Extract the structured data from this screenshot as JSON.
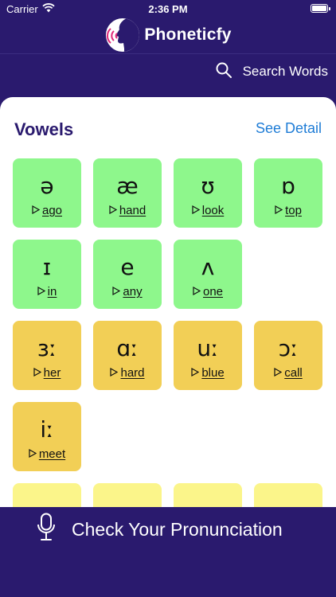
{
  "status": {
    "carrier": "Carrier",
    "time": "2:36 PM"
  },
  "header": {
    "title": "Phoneticfy"
  },
  "search": {
    "label": "Search Words"
  },
  "section": {
    "title": "Vowels",
    "detail_link": "See Detail"
  },
  "colors": {
    "green": "#8ef78c",
    "orange": "#f2cf56",
    "yellow": "#fbf58a",
    "brand": "#2a1a6e",
    "link": "#1e7cd6"
  },
  "vowels": [
    {
      "symbol": "ə",
      "word": "ago",
      "color": "green"
    },
    {
      "symbol": "æ",
      "word": "hand",
      "color": "green"
    },
    {
      "symbol": "ʊ",
      "word": "look",
      "color": "green"
    },
    {
      "symbol": "ɒ",
      "word": "top",
      "color": "green"
    },
    {
      "symbol": "ɪ",
      "word": "in",
      "color": "green"
    },
    {
      "symbol": "e",
      "word": "any",
      "color": "green"
    },
    {
      "symbol": "ʌ",
      "word": "one",
      "color": "green"
    },
    null,
    {
      "symbol": "ɜː",
      "word": "her",
      "color": "orange"
    },
    {
      "symbol": "ɑː",
      "word": "hard",
      "color": "orange"
    },
    {
      "symbol": "uː",
      "word": "blue",
      "color": "orange"
    },
    {
      "symbol": "ɔː",
      "word": "call",
      "color": "orange"
    },
    {
      "symbol": "iː",
      "word": "meet",
      "color": "orange"
    },
    null,
    null,
    null,
    {
      "symbol": "",
      "word": "",
      "color": "yellow"
    },
    {
      "symbol": "",
      "word": "",
      "color": "yellow"
    },
    {
      "symbol": "",
      "word": "",
      "color": "yellow"
    },
    {
      "symbol": "",
      "word": "",
      "color": "yellow"
    }
  ],
  "play_icon": "play-triangle-icon",
  "bottom": {
    "button_label": "Check Your Pronunciation",
    "icon": "microphone-icon"
  }
}
